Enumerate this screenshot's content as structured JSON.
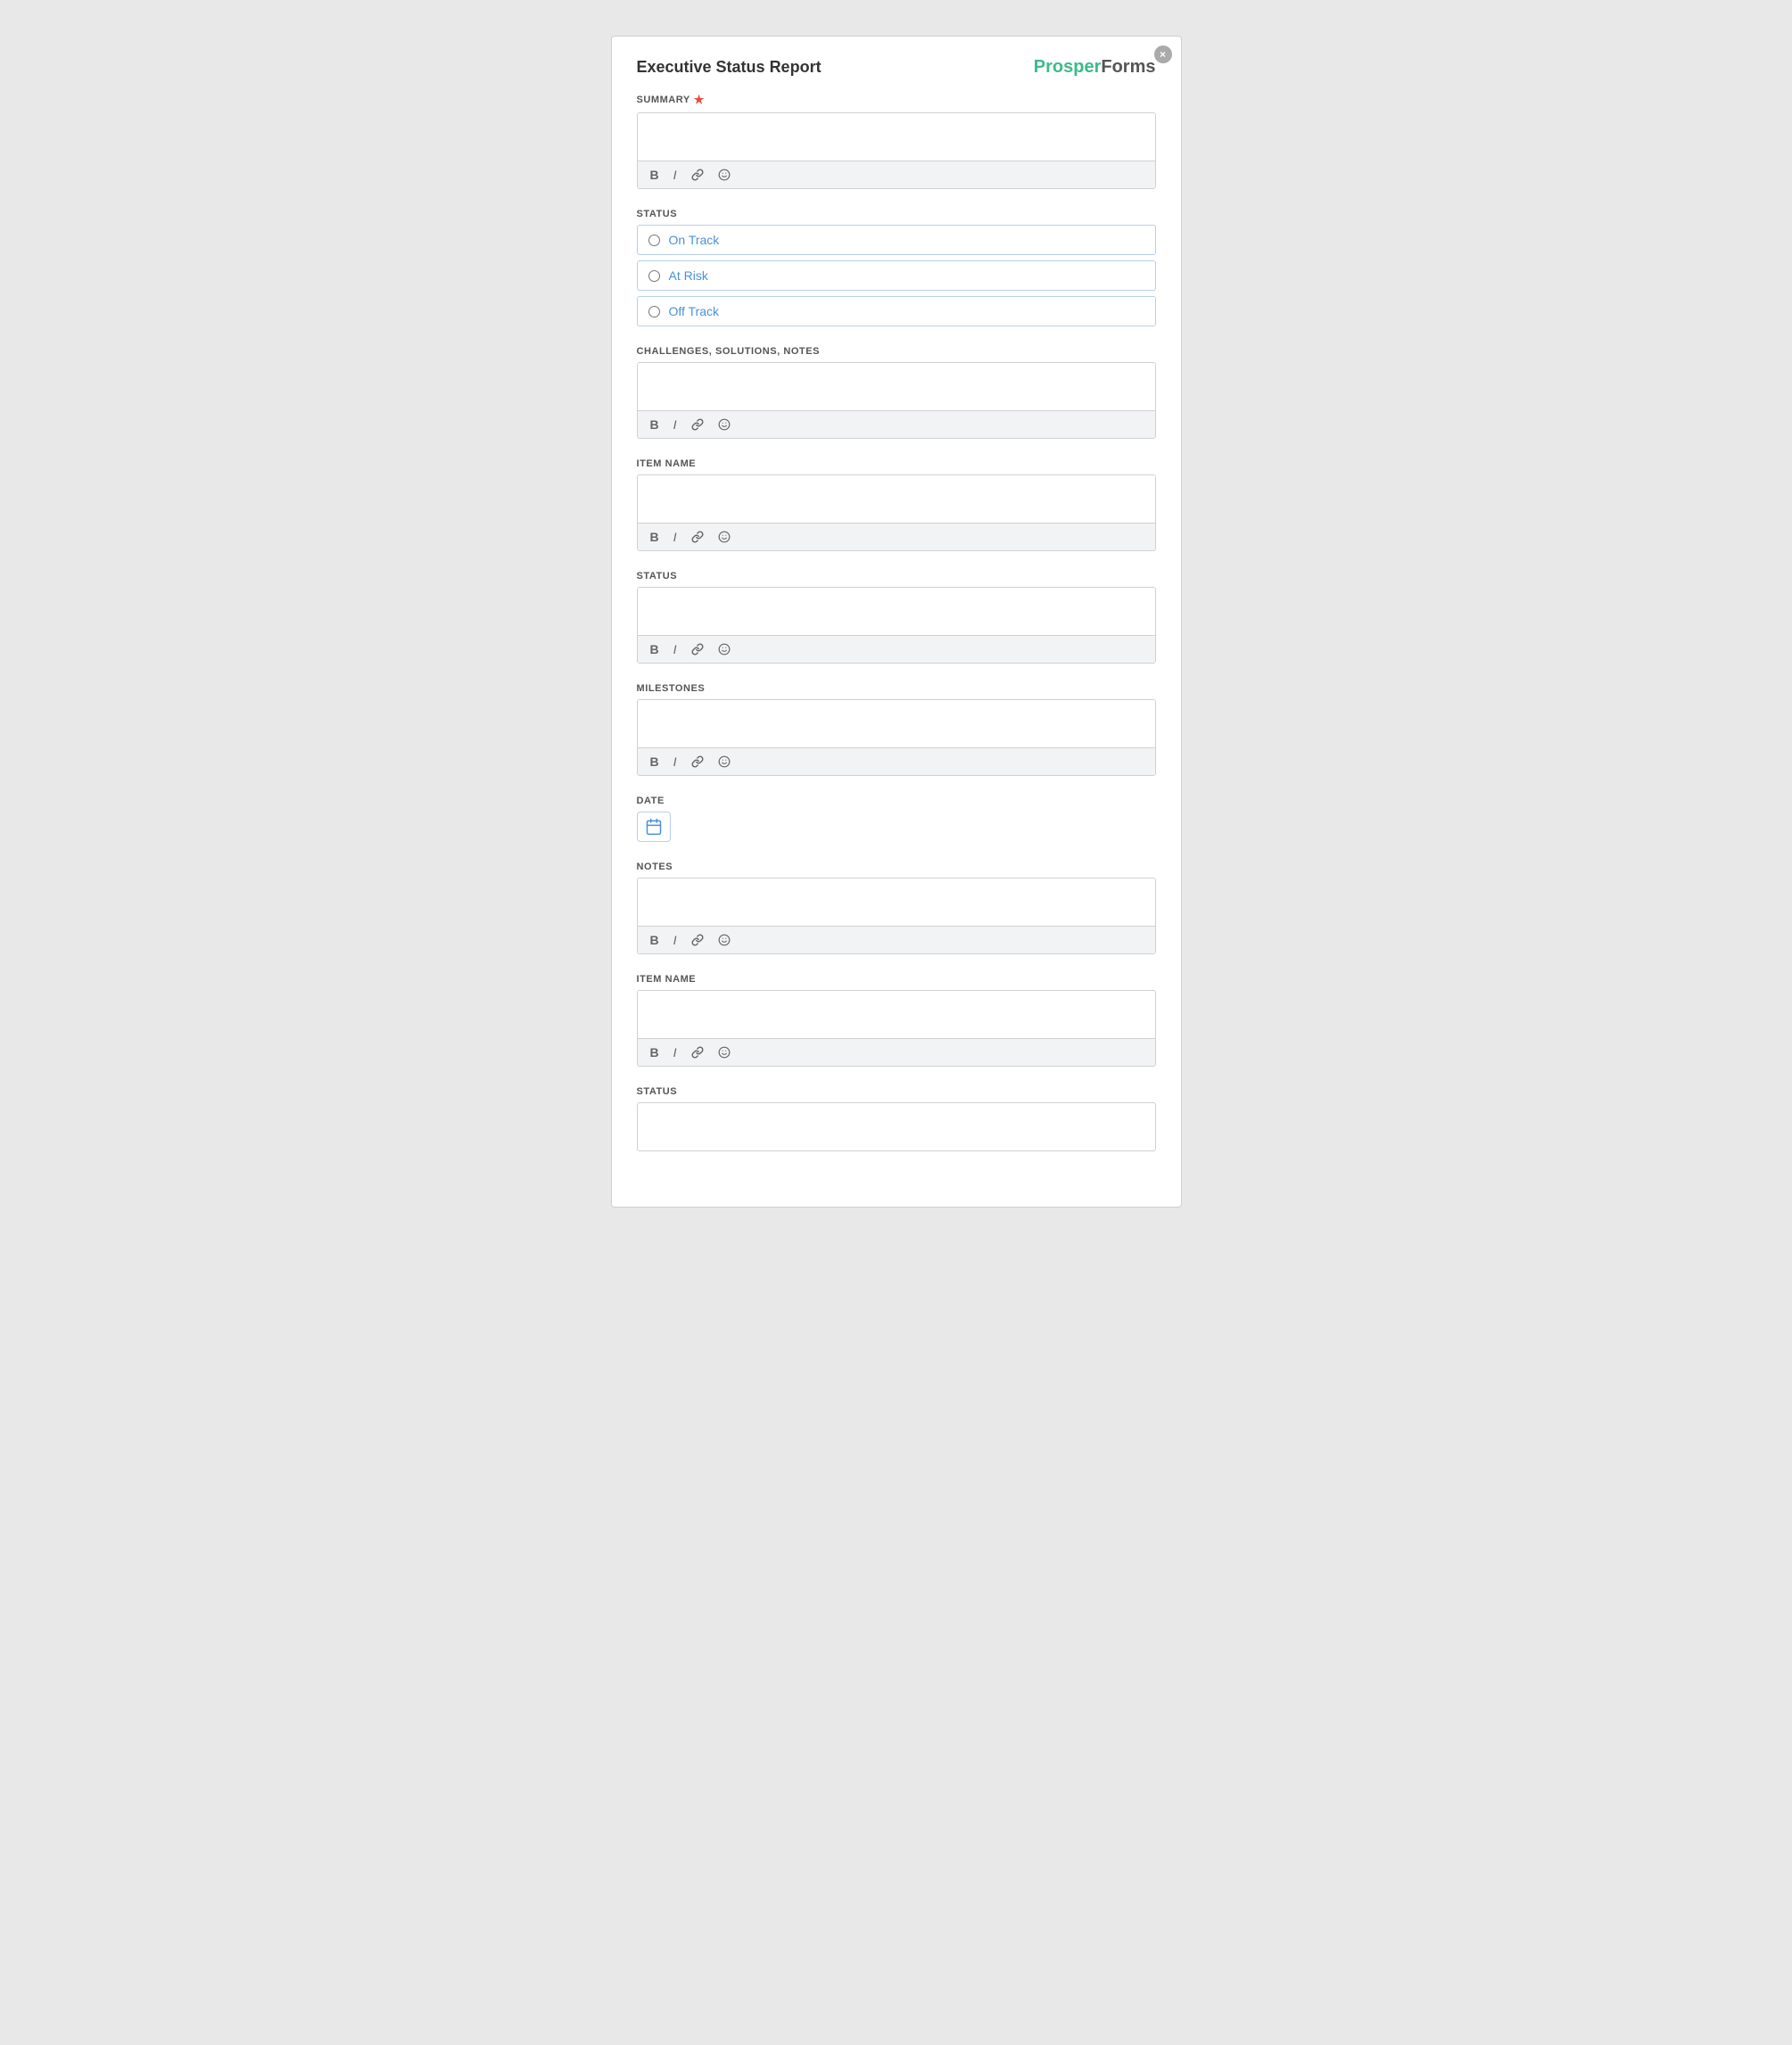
{
  "app": {
    "logo_prosper": "Prosper",
    "logo_forms": "Forms"
  },
  "form": {
    "title": "Executive Status Report",
    "close_label": "×",
    "fields": {
      "summary": {
        "label": "SUMMARY",
        "required": true,
        "placeholder": "",
        "toolbar": {
          "bold": "B",
          "italic": "I",
          "link": "🔗",
          "emoji": "🙂"
        }
      },
      "status_radio": {
        "label": "STATUS",
        "options": [
          {
            "id": "on-track",
            "value": "on_track",
            "label": "On Track"
          },
          {
            "id": "at-risk",
            "value": "at_risk",
            "label": "At Risk"
          },
          {
            "id": "off-track",
            "value": "off_track",
            "label": "Off Track"
          }
        ]
      },
      "challenges": {
        "label": "CHALLENGES, SOLUTIONS, NOTES",
        "placeholder": "",
        "toolbar": {
          "bold": "B",
          "italic": "I",
          "link": "🔗",
          "emoji": "🙂"
        }
      },
      "item_name_1": {
        "label": "ITEM NAME",
        "placeholder": "",
        "toolbar": {
          "bold": "B",
          "italic": "I",
          "link": "🔗",
          "emoji": "🙂"
        }
      },
      "status_text_1": {
        "label": "STATUS",
        "placeholder": "",
        "toolbar": {
          "bold": "B",
          "italic": "I",
          "link": "🔗",
          "emoji": "🙂"
        }
      },
      "milestones": {
        "label": "MILESTONES",
        "placeholder": "",
        "toolbar": {
          "bold": "B",
          "italic": "I",
          "link": "🔗",
          "emoji": "🙂"
        }
      },
      "date": {
        "label": "DATE",
        "btn_label": "📅"
      },
      "notes": {
        "label": "NOTES",
        "placeholder": "",
        "toolbar": {
          "bold": "B",
          "italic": "I",
          "link": "🔗",
          "emoji": "🙂"
        }
      },
      "item_name_2": {
        "label": "ITEM NAME",
        "placeholder": "",
        "toolbar": {
          "bold": "B",
          "italic": "I",
          "link": "🔗",
          "emoji": "🙂"
        }
      },
      "status_text_2": {
        "label": "STATUS",
        "placeholder": ""
      }
    }
  }
}
